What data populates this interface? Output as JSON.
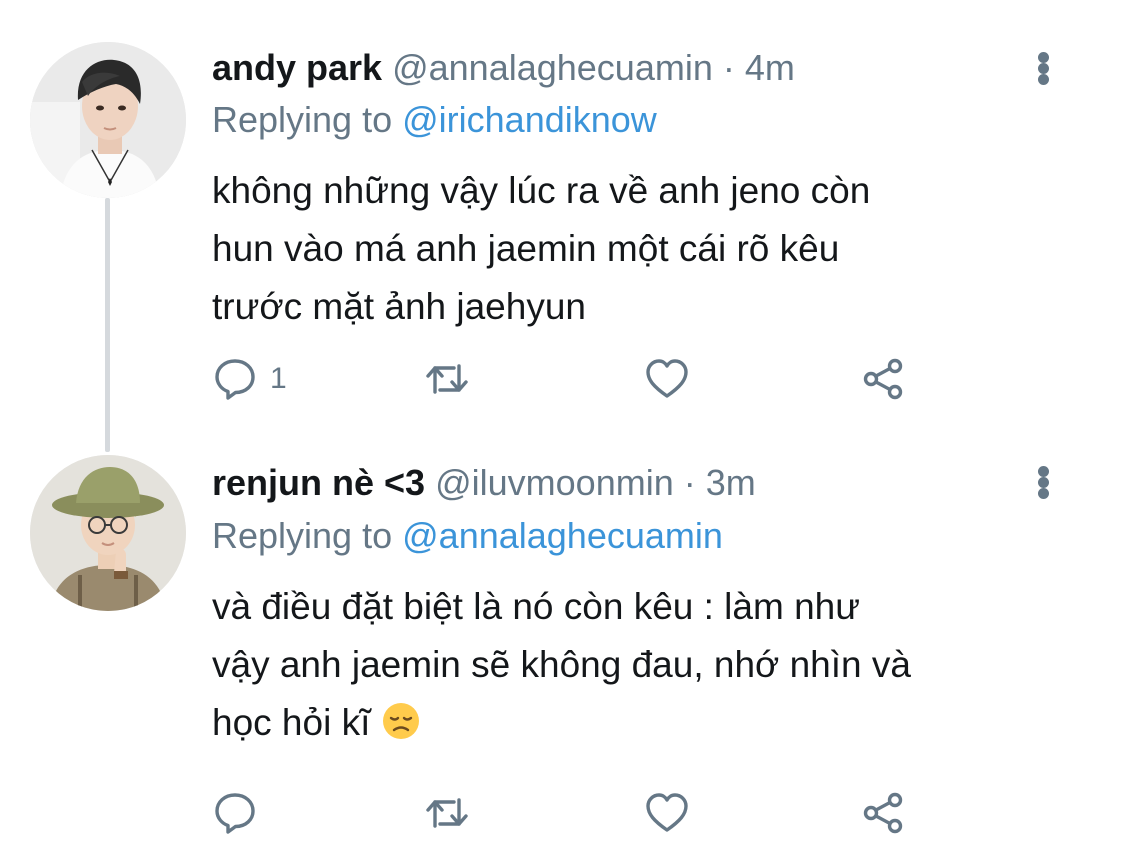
{
  "tweets": [
    {
      "display_name": "andy park",
      "handle": "@annalaghecuamin",
      "separator": "·",
      "time": "4m",
      "replying_prefix": "Replying to",
      "replying_to": "@irichandiknow",
      "text_lines": [
        "không những vậy lúc ra về anh jeno còn",
        "hun vào má anh jaemin một cái rõ kêu",
        "trước mặt ảnh jaehyun"
      ],
      "reply_count": "1"
    },
    {
      "display_name": "renjun nè <3",
      "handle": "@iluvmoonmin",
      "separator": "·",
      "time": "3m",
      "replying_prefix": "Replying to",
      "replying_to": "@annalaghecuamin",
      "text_lines": [
        "và điều đặt biệt là nó còn kêu : làm như",
        "vậy anh jaemin sẽ không đau, nhớ nhìn và",
        "học hỏi kĩ"
      ],
      "text_emoji": "disappointed-face-emoji",
      "reply_count": ""
    }
  ],
  "icons": {
    "reply": "reply-icon",
    "retweet": "retweet-icon",
    "like": "heart-icon",
    "share": "share-icon",
    "more": "more-vertical-icon"
  },
  "colors": {
    "text": "#14171a",
    "secondary": "#657786",
    "link": "#3b94d9",
    "thread_line": "#d5d9dd"
  }
}
